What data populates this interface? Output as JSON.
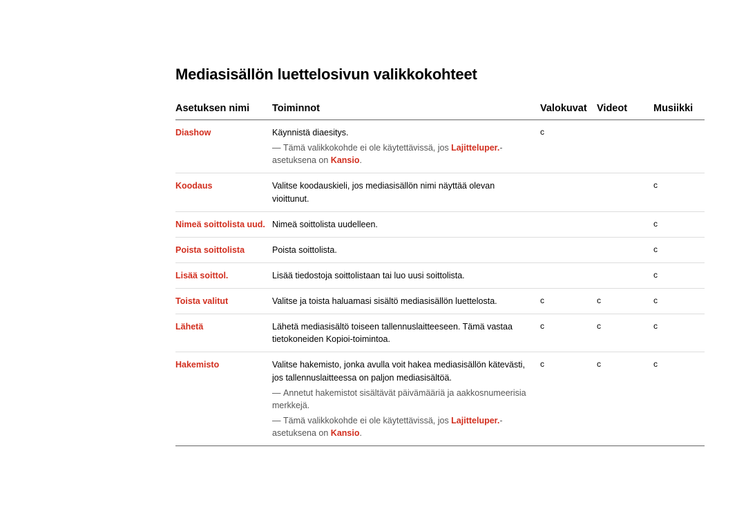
{
  "title": "Mediasisällön luettelosivun valikkokohteet",
  "headers": {
    "name": "Asetuksen nimi",
    "func": "Toiminnot",
    "col1": "Valokuvat",
    "col2": "Videot",
    "col3": "Musiikki"
  },
  "check": "c",
  "dash": "―",
  "rows": {
    "diashow": {
      "name": "Diashow",
      "desc": "Käynnistä diaesitys.",
      "note_pre": "Tämä valikkokohde ei ole käytettävissä, jos ",
      "note_hl1": "Lajitteluper.",
      "note_mid": "-asetuksena on ",
      "note_hl2": "Kansio",
      "note_post": "."
    },
    "koodaus": {
      "name": "Koodaus",
      "desc": "Valitse koodauskieli, jos mediasisällön nimi näyttää olevan vioittunut."
    },
    "nimea": {
      "name": "Nimeä soittolista uud.",
      "desc": "Nimeä soittolista uudelleen."
    },
    "poista": {
      "name": "Poista soittolista",
      "desc": "Poista soittolista."
    },
    "lisaa": {
      "name": "Lisää soittol.",
      "desc": "Lisää tiedostoja soittolistaan tai luo uusi soittolista."
    },
    "toista": {
      "name": "Toista valitut",
      "desc": "Valitse ja toista haluamasi sisältö mediasisällön luettelosta."
    },
    "laheta": {
      "name": "Lähetä",
      "desc": "Lähetä mediasisältö toiseen tallennuslaitteeseen. Tämä vastaa tietokoneiden Kopioi-toimintoa."
    },
    "hakemisto": {
      "name": "Hakemisto",
      "desc": "Valitse hakemisto, jonka avulla voit hakea mediasisällön kätevästi, jos tallennuslaitteessa on paljon mediasisältöä.",
      "note1": "Annetut hakemistot sisältävät päivämääriä ja aakkosnumeerisia merkkejä.",
      "note2_pre": "Tämä valikkokohde ei ole käytettävissä, jos ",
      "note2_hl1": "Lajitteluper.",
      "note2_mid": "-asetuksena on ",
      "note2_hl2": "Kansio",
      "note2_post": "."
    }
  }
}
